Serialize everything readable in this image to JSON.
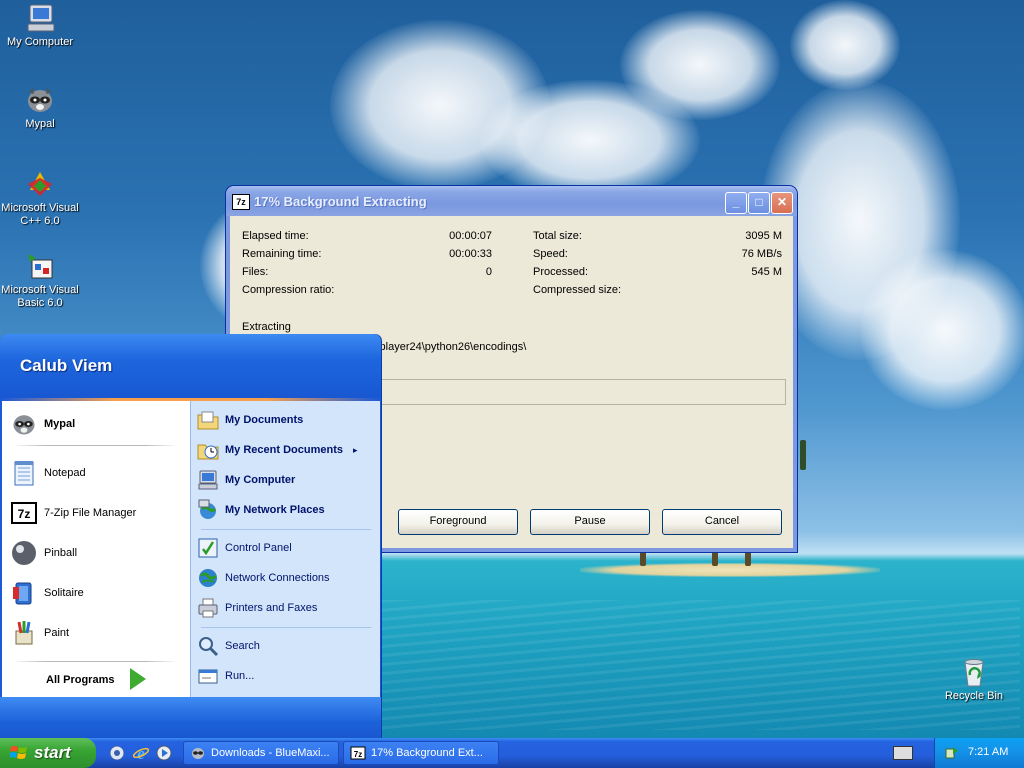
{
  "desktop": {
    "icons": [
      {
        "label": "My Computer",
        "icon": "my-computer-icon"
      },
      {
        "label": "Mypal",
        "icon": "mypal-raccoon-icon"
      },
      {
        "label": "Microsoft Visual C++ 6.0",
        "icon": "visual-cpp-icon"
      },
      {
        "label": "Microsoft Visual Basic 6.0",
        "icon": "visual-basic-icon"
      },
      {
        "label": "Recycle Bin",
        "icon": "recycle-bin-icon"
      }
    ]
  },
  "window": {
    "title": "17% Background Extracting",
    "app_icon_text": "7z",
    "progress_percent": 17,
    "stats": {
      "elapsed_label": "Elapsed time:",
      "elapsed_value": "00:00:07",
      "remaining_label": "Remaining time:",
      "remaining_value": "00:00:33",
      "files_label": "Files:",
      "files_value": "0",
      "ratio_label": "Compression ratio:",
      "ratio_value": "",
      "total_label": "Total size:",
      "total_value": "3095 M",
      "speed_label": "Speed:",
      "speed_value": "76 MB/s",
      "processed_label": "Processed:",
      "processed_value": "545 M",
      "compressed_label": "Compressed size:",
      "compressed_value": ""
    },
    "status_label": "Extracting",
    "current_path": "tware\\Brows ... gins\\Burster\\player24\\python26\\encodings\\",
    "buttons": {
      "foreground": "Foreground",
      "pause": "Pause",
      "cancel": "Cancel"
    },
    "controls": {
      "minimize": "_",
      "maximize": "□",
      "close": "✕"
    }
  },
  "start_menu": {
    "user_name": "Calub Viem",
    "pinned": [
      {
        "label": "Mypal",
        "icon": "mypal-raccoon-icon"
      }
    ],
    "recent": [
      {
        "label": "Notepad",
        "icon": "notepad-icon"
      },
      {
        "label": "7-Zip File Manager",
        "icon": "seven-zip-icon"
      },
      {
        "label": "Pinball",
        "icon": "pinball-icon"
      },
      {
        "label": "Solitaire",
        "icon": "solitaire-icon"
      },
      {
        "label": "Paint",
        "icon": "paint-icon"
      }
    ],
    "all_programs": "All Programs",
    "right": [
      {
        "label": "My Documents",
        "icon": "my-documents-icon"
      },
      {
        "label": "My Recent Documents",
        "icon": "recent-documents-icon",
        "arrow": "▸"
      },
      {
        "label": "My Computer",
        "icon": "my-computer-icon"
      },
      {
        "label": "My Network Places",
        "icon": "network-places-icon"
      },
      {
        "label": "Control Panel",
        "icon": "control-panel-icon"
      },
      {
        "label": "Network Connections",
        "icon": "network-connections-icon"
      },
      {
        "label": "Printers and Faxes",
        "icon": "printer-icon"
      },
      {
        "label": "Search",
        "icon": "search-icon"
      },
      {
        "label": "Run...",
        "icon": "run-icon"
      }
    ]
  },
  "taskbar": {
    "start_label": "start",
    "tasks": [
      {
        "label": "Downloads - BlueMaxi...",
        "icon": "mypal-raccoon-icon"
      },
      {
        "label": "17% Background Ext...",
        "icon": "seven-zip-icon"
      }
    ],
    "clock": "7:21 AM"
  }
}
